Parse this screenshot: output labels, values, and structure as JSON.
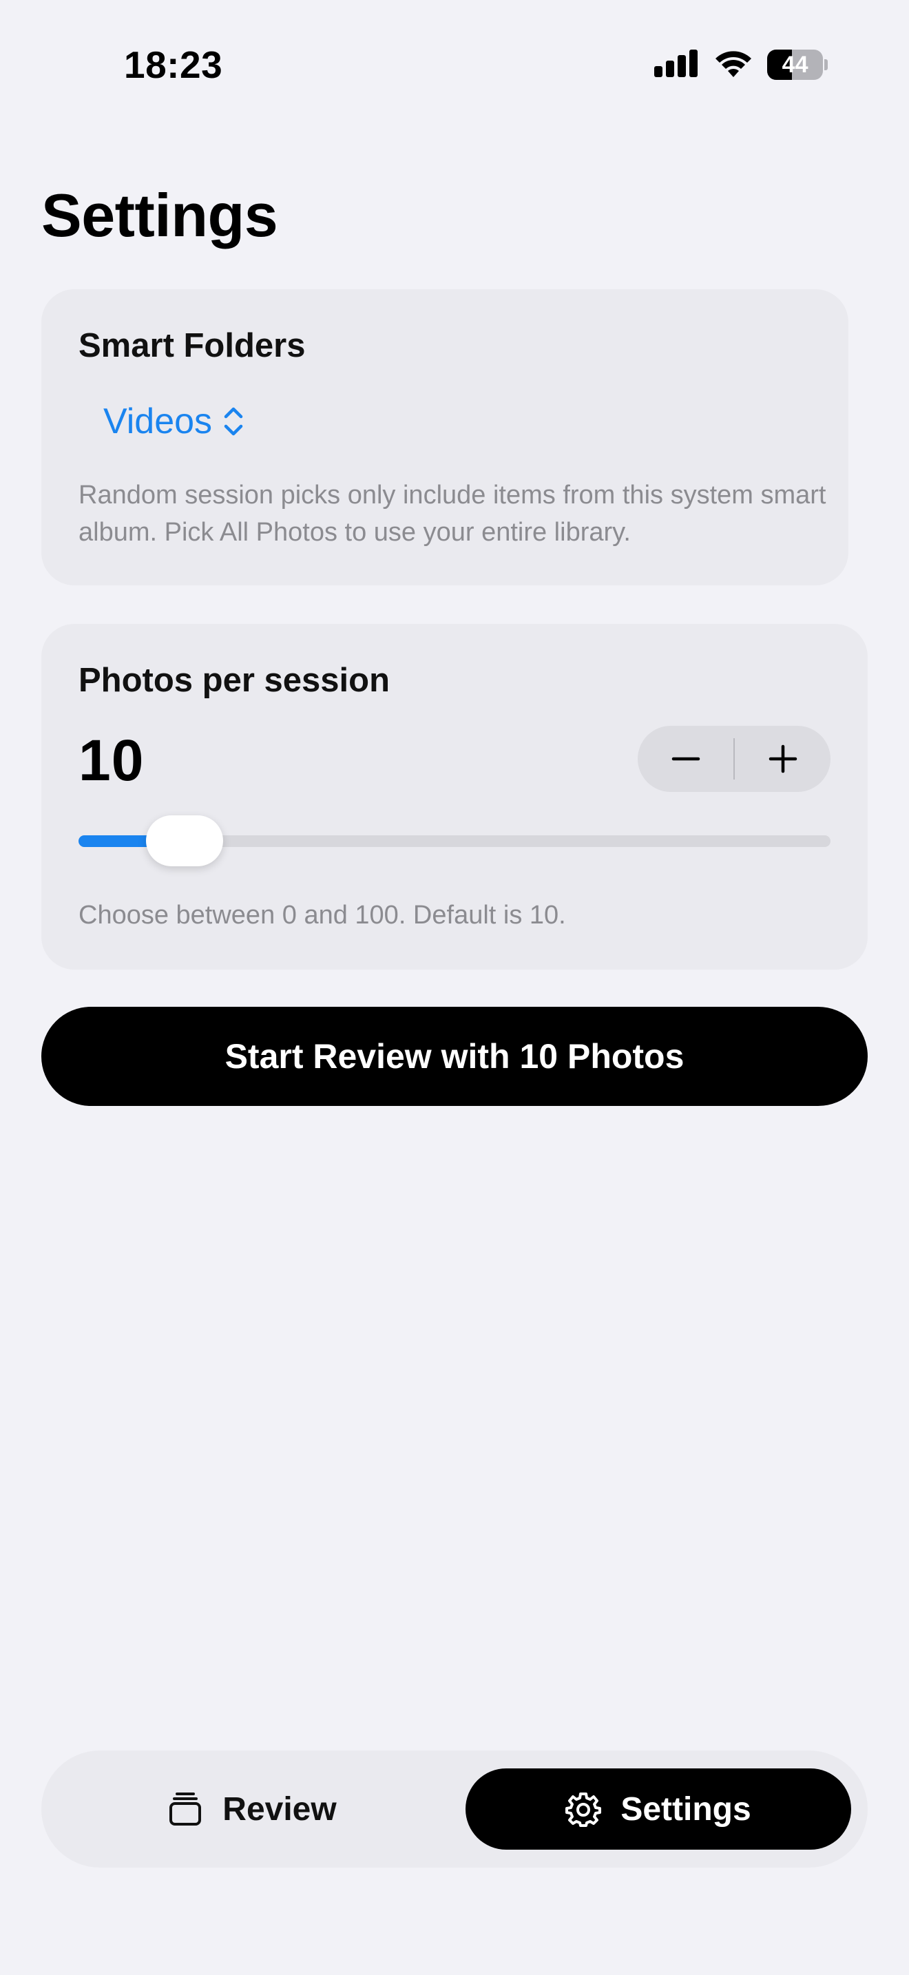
{
  "status_bar": {
    "time": "18:23",
    "battery_level": "44",
    "icons": [
      "signal-icon",
      "wifi-icon",
      "battery-icon"
    ]
  },
  "page": {
    "title": "Settings"
  },
  "smart_folders": {
    "heading": "Smart Folders",
    "selected_option": "Videos",
    "picker_icon": "chevron-up-down-icon",
    "note": "Random session picks only include items from this system smart album. Pick All Photos to use your entire library."
  },
  "session": {
    "heading": "Photos per session",
    "value": "10",
    "slider_min": 0,
    "slider_max": 100,
    "slider_value": 10,
    "stepper_icons": [
      "minus-icon",
      "plus-icon"
    ],
    "note": "Choose between 0 and 100. Default is 10."
  },
  "start_button": {
    "label": "Start Review with 10 Photos"
  },
  "tab_bar": {
    "tabs": [
      {
        "label": "Review",
        "icon": "stack-icon",
        "selected": false
      },
      {
        "label": "Settings",
        "icon": "gear-icon",
        "selected": true
      }
    ]
  },
  "colors": {
    "background": "#f2f2f7",
    "card": "#eaeaef",
    "accent": "#1a84ef",
    "secondary_text": "#8b8b90"
  }
}
